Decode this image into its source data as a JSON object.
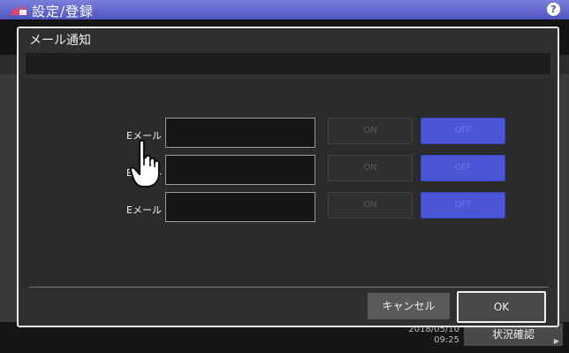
{
  "header": {
    "title": "設定/登録",
    "help_symbol": "?",
    "icons": {
      "app": "settings-register-icon",
      "help": "help-icon"
    }
  },
  "dialog": {
    "title": "メール通知",
    "message": "",
    "rows": [
      {
        "label": "Eメール",
        "value": "",
        "on_label": "ON",
        "off_label": "OFF",
        "selected": "OFF"
      },
      {
        "label": "Eメール",
        "value": "",
        "on_label": "ON",
        "off_label": "OFF",
        "selected": "OFF"
      },
      {
        "label": "Eメール",
        "value": "",
        "on_label": "ON",
        "off_label": "OFF",
        "selected": "OFF"
      }
    ],
    "cancel_label": "キャンセル",
    "ok_label": "OK"
  },
  "footer": {
    "date": "2018/05/10",
    "time": "09:25",
    "status_label": "状況確認"
  },
  "colors": {
    "header": "#5a60c8",
    "selected_off": "#4b56d6",
    "dialog_border": "#e8e8e8"
  }
}
